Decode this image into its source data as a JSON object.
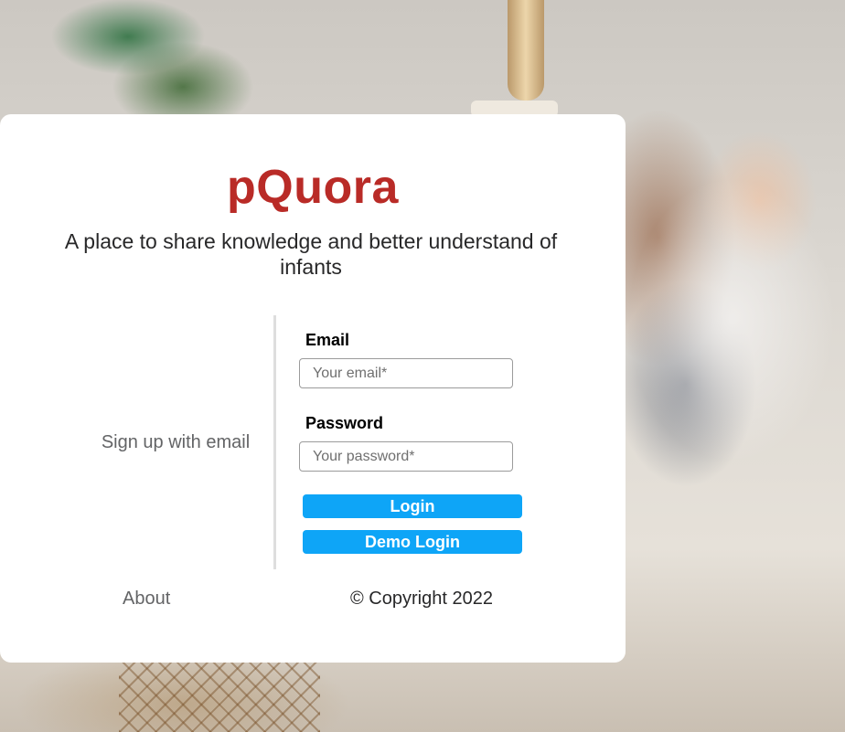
{
  "brand": {
    "name": "pQuora",
    "color": "#b92b27"
  },
  "tagline": "A place to share knowledge and better understand of infants",
  "signup": {
    "label": "Sign up with email"
  },
  "form": {
    "email_label": "Email",
    "email_placeholder": "Your email*",
    "email_value": "",
    "password_label": "Password",
    "password_placeholder": "Your password*",
    "password_value": "",
    "login_label": "Login",
    "demo_login_label": "Demo Login",
    "button_color": "#0ea5f7"
  },
  "footer": {
    "about_label": "About",
    "copyright": "© Copyright 2022"
  }
}
